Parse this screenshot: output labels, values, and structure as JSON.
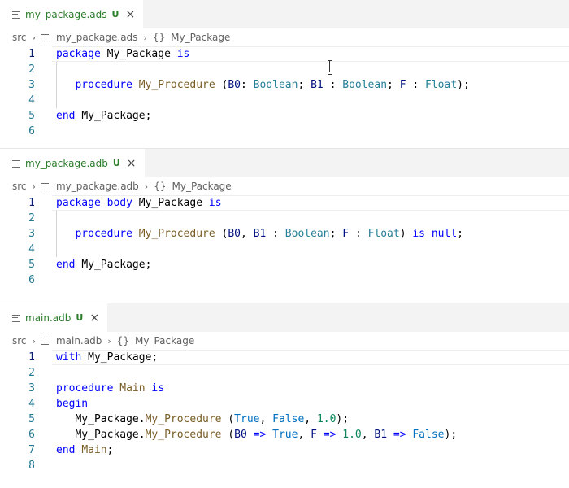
{
  "editors": [
    {
      "tab": {
        "title": "my_package.ads",
        "status": "U",
        "close": "×"
      },
      "breadcrumb": {
        "root": "src",
        "file": "my_package.ads",
        "symbol": "My_Package"
      },
      "lines": [
        "1",
        "2",
        "3",
        "4",
        "5",
        "6"
      ]
    },
    {
      "tab": {
        "title": "my_package.adb",
        "status": "U",
        "close": "×"
      },
      "breadcrumb": {
        "root": "src",
        "file": "my_package.adb",
        "symbol": "My_Package"
      },
      "lines": [
        "1",
        "2",
        "3",
        "4",
        "5",
        "6"
      ]
    },
    {
      "tab": {
        "title": "main.adb",
        "status": "U",
        "close": "×"
      },
      "breadcrumb": {
        "root": "src",
        "file": "main.adb",
        "symbol": "My_Package"
      },
      "lines": [
        "1",
        "2",
        "3",
        "4",
        "5",
        "6",
        "7",
        "8"
      ]
    }
  ],
  "code": {
    "ads": {
      "l1": {
        "kw1": "package",
        "name": "My_Package",
        "kw2": "is"
      },
      "l3": {
        "kw": "procedure",
        "fn": "My_Procedure",
        "p0": "B0",
        "t0": "Boolean",
        "p1": "B1",
        "t1": "Boolean",
        "p2": "F",
        "t2": "Float"
      },
      "l5": {
        "kw": "end",
        "name": "My_Package"
      }
    },
    "adb": {
      "l1": {
        "kw1": "package",
        "kw2": "body",
        "name": "My_Package",
        "kw3": "is"
      },
      "l3": {
        "kw": "procedure",
        "fn": "My_Procedure",
        "p0": "B0",
        "p1": "B1",
        "t0": "Boolean",
        "p2": "F",
        "t1": "Float",
        "kw2": "is",
        "kw3": "null"
      },
      "l5": {
        "kw": "end",
        "name": "My_Package"
      }
    },
    "main": {
      "l1": {
        "kw": "with",
        "name": "My_Package"
      },
      "l3": {
        "kw1": "procedure",
        "fn": "Main",
        "kw2": "is"
      },
      "l4": {
        "kw": "begin"
      },
      "l5": {
        "pkg": "My_Package",
        "fn": "My_Procedure",
        "a0": "True",
        "a1": "False",
        "a2": "1.0"
      },
      "l6": {
        "pkg": "My_Package",
        "fn": "My_Procedure",
        "p0": "B0",
        "v0": "True",
        "p1": "F",
        "v1": "1.0",
        "p2": "B1",
        "v2": "False"
      },
      "l7": {
        "kw": "end",
        "fn": "Main"
      }
    }
  }
}
